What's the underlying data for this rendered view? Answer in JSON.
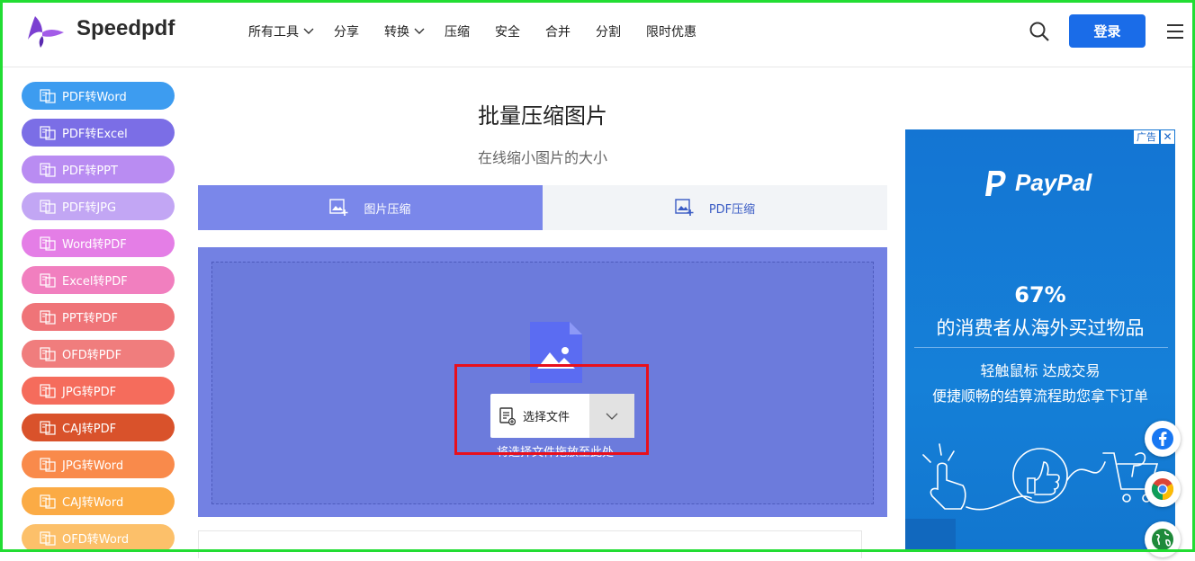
{
  "header": {
    "brand": "Speedpdf",
    "nav": [
      {
        "label": "所有工具",
        "dropdown": true
      },
      {
        "label": "分享",
        "dropdown": false
      },
      {
        "label": "转换",
        "dropdown": true
      },
      {
        "label": "压缩",
        "dropdown": false
      },
      {
        "label": "安全",
        "dropdown": false
      },
      {
        "label": "合并",
        "dropdown": false
      },
      {
        "label": "分割",
        "dropdown": false
      },
      {
        "label": "限时优惠",
        "dropdown": false
      }
    ],
    "login_label": "登录",
    "icons": [
      "search-icon",
      "menu-icon"
    ]
  },
  "sidebar": {
    "items": [
      {
        "label": "PDF转Word",
        "color": "#3d9cf0"
      },
      {
        "label": "PDF转Excel",
        "color": "#7b6ee6"
      },
      {
        "label": "PDF转PPT",
        "color": "#b98cf2"
      },
      {
        "label": "PDF转JPG",
        "color": "#c2a6f4"
      },
      {
        "label": "Word转PDF",
        "color": "#e47ee6"
      },
      {
        "label": "Excel转PDF",
        "color": "#f17fbf"
      },
      {
        "label": "PPT转PDF",
        "color": "#ef7478"
      },
      {
        "label": "OFD转PDF",
        "color": "#f07d7d"
      },
      {
        "label": "JPG转PDF",
        "color": "#f56c5c"
      },
      {
        "label": "CAJ转PDF",
        "color": "#d9522b"
      },
      {
        "label": "JPG转Word",
        "color": "#f98a4b"
      },
      {
        "label": "CAJ转Word",
        "color": "#fbab45"
      },
      {
        "label": "OFD转Word",
        "color": "#fcc06a"
      }
    ]
  },
  "main": {
    "title": "批量压缩图片",
    "subtitle": "在线缩小图片的大小",
    "tabs": [
      {
        "label": "图片压缩",
        "active": true
      },
      {
        "label": "PDF压缩",
        "active": false
      }
    ],
    "upload": {
      "choose_label": "选择文件",
      "drag_hint": "将选择文件拖放至此处"
    }
  },
  "ad": {
    "tag": "广告",
    "close": "✕",
    "brand": "PayPal",
    "percent": "67%",
    "line1": "的消费者从海外买过物品",
    "line2": "轻触鼠标 达成交易",
    "line3": "便捷顺畅的结算流程助您拿下订单"
  },
  "floating_icons": [
    "facebook-icon",
    "chrome-icon",
    "globe-icon"
  ],
  "colors": {
    "accent": "#1a6ce8",
    "tab_active": "#7a87ea",
    "upload_bg": "#7381e3",
    "highlight": "#e8101c"
  }
}
